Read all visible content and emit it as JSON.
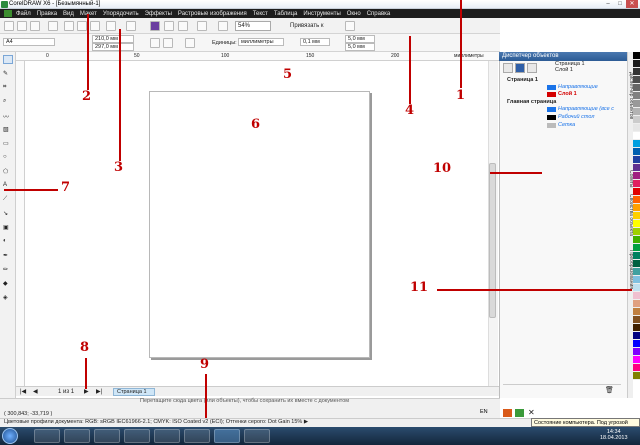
{
  "window": {
    "title": "CorelDRAW X6 - [Безымянный-1]"
  },
  "menu": [
    "Файл",
    "Правка",
    "Вид",
    "Макет",
    "Упорядочить",
    "Эффекты",
    "Растровые изображения",
    "Текст",
    "Таблица",
    "Инструменты",
    "Окно",
    "Справка"
  ],
  "toolbar": {
    "zoom": "54%",
    "snap": "Привязать к"
  },
  "property_bar": {
    "page_size": "A4",
    "width": "210,0 мм",
    "height": "297,0 мм",
    "units_label": "Единицы:",
    "units": "миллиметры",
    "nudge": "0,1 мм",
    "dup_x": "5,0 мм",
    "dup_y": "5,0 мм"
  },
  "ruler": {
    "units": "миллиметры",
    "ticks": [
      "0",
      "50",
      "100",
      "150",
      "200",
      "250"
    ]
  },
  "docker": {
    "title": "Диспетчер объектов",
    "header": "Страница 1",
    "sub_header": "Слой 1",
    "rows": [
      {
        "label": "Страница 1",
        "bold": true
      },
      {
        "label": "Направляющие",
        "color": "#1a73e8"
      },
      {
        "label": "Слой 1",
        "color": "#d40000"
      },
      {
        "label": "Главная страница",
        "bold": true
      },
      {
        "label": "Направляющие (все с",
        "color": "#1a73e8"
      },
      {
        "label": "Рабочий стол",
        "color": "#1a73e8"
      },
      {
        "label": "Сетка",
        "color": "#1a73e8"
      }
    ],
    "side_tabs": [
      "Диспетчер объектов",
      "Советы",
      "Свойства объекта",
      "Преобразования"
    ]
  },
  "page_nav": {
    "counter": "1 из 1",
    "tab": "Страница 1"
  },
  "status": {
    "hint": "Перетащите сюда цвета (или объекты), чтобы сохранить их вместе с документом",
    "coords": "( 300,843; -33,719 )",
    "profiles": "Цветовые профили документа: RGB: sRGB IEC61966-2.1; CMYK: ISO Coated v2 (ECI); Оттенки серого: Dot Gain 15% ▶",
    "tooltip": "Состояние компьютера. Под угрозой",
    "lang": "EN"
  },
  "taskbar": {
    "time": "14:34",
    "date": "18.04.2013"
  },
  "annotations": [
    "1",
    "2",
    "3",
    "4",
    "5",
    "6",
    "7",
    "8",
    "9",
    "10",
    "11"
  ],
  "palette": [
    "#000000",
    "#1a1a1a",
    "#333333",
    "#4d4d4d",
    "#666666",
    "#808080",
    "#999999",
    "#b3b3b3",
    "#cccccc",
    "#e6e6e6",
    "#ffffff",
    "#00a0e0",
    "#0060b0",
    "#2040a0",
    "#603090",
    "#a02080",
    "#e02060",
    "#e00000",
    "#ff6000",
    "#ffa000",
    "#ffd000",
    "#ffff00",
    "#a0d000",
    "#40b000",
    "#00a040",
    "#008060",
    "#006040",
    "#40a0a0",
    "#80c0e0",
    "#c0e0f0",
    "#f0c0d0",
    "#e0a080",
    "#c08040",
    "#805020",
    "#402000",
    "#000080",
    "#0000ff",
    "#8000ff",
    "#ff00ff",
    "#ff0080",
    "#808000"
  ]
}
